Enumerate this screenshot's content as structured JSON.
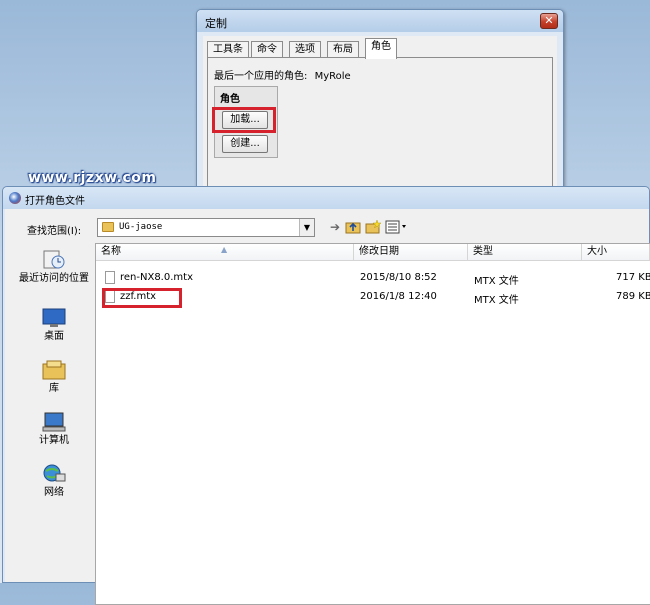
{
  "customize_dialog": {
    "title": "定制",
    "close": "✕",
    "tabs": [
      {
        "label": "工具条"
      },
      {
        "label": "命令"
      },
      {
        "label": "选项"
      },
      {
        "label": "布局"
      },
      {
        "label": "角色"
      }
    ],
    "last_role_label": "最后一个应用的角色:",
    "last_role_value": "MyRole",
    "role_group_title": "角色",
    "load_button": "加载...",
    "create_button": "创建..."
  },
  "watermark": "www.rjzxw.com",
  "open_dialog": {
    "title": "打开角色文件",
    "look_in_label": "查找范围(I):",
    "look_in_value": "UG-jaose",
    "places": [
      {
        "label": "最近访问的位置",
        "icon": "recent-places-icon"
      },
      {
        "label": "桌面",
        "icon": "desktop-icon"
      },
      {
        "label": "库",
        "icon": "libraries-icon"
      },
      {
        "label": "计算机",
        "icon": "computer-icon"
      },
      {
        "label": "网络",
        "icon": "network-icon"
      }
    ],
    "columns": {
      "name": "名称",
      "modified": "修改日期",
      "type": "类型",
      "size": "大小"
    },
    "files": [
      {
        "name": "ren-NX8.0.mtx",
        "modified": "2015/8/10 8:52",
        "type": "MTX 文件",
        "size": "717 KB"
      },
      {
        "name": "zzf.mtx",
        "modified": "2016/1/8 12:40",
        "type": "MTX 文件",
        "size": "789 KB"
      }
    ]
  },
  "colors": {
    "highlight_box": "#d6222c",
    "close_button": "#c5402b",
    "title_bar": "#b4cde8"
  }
}
